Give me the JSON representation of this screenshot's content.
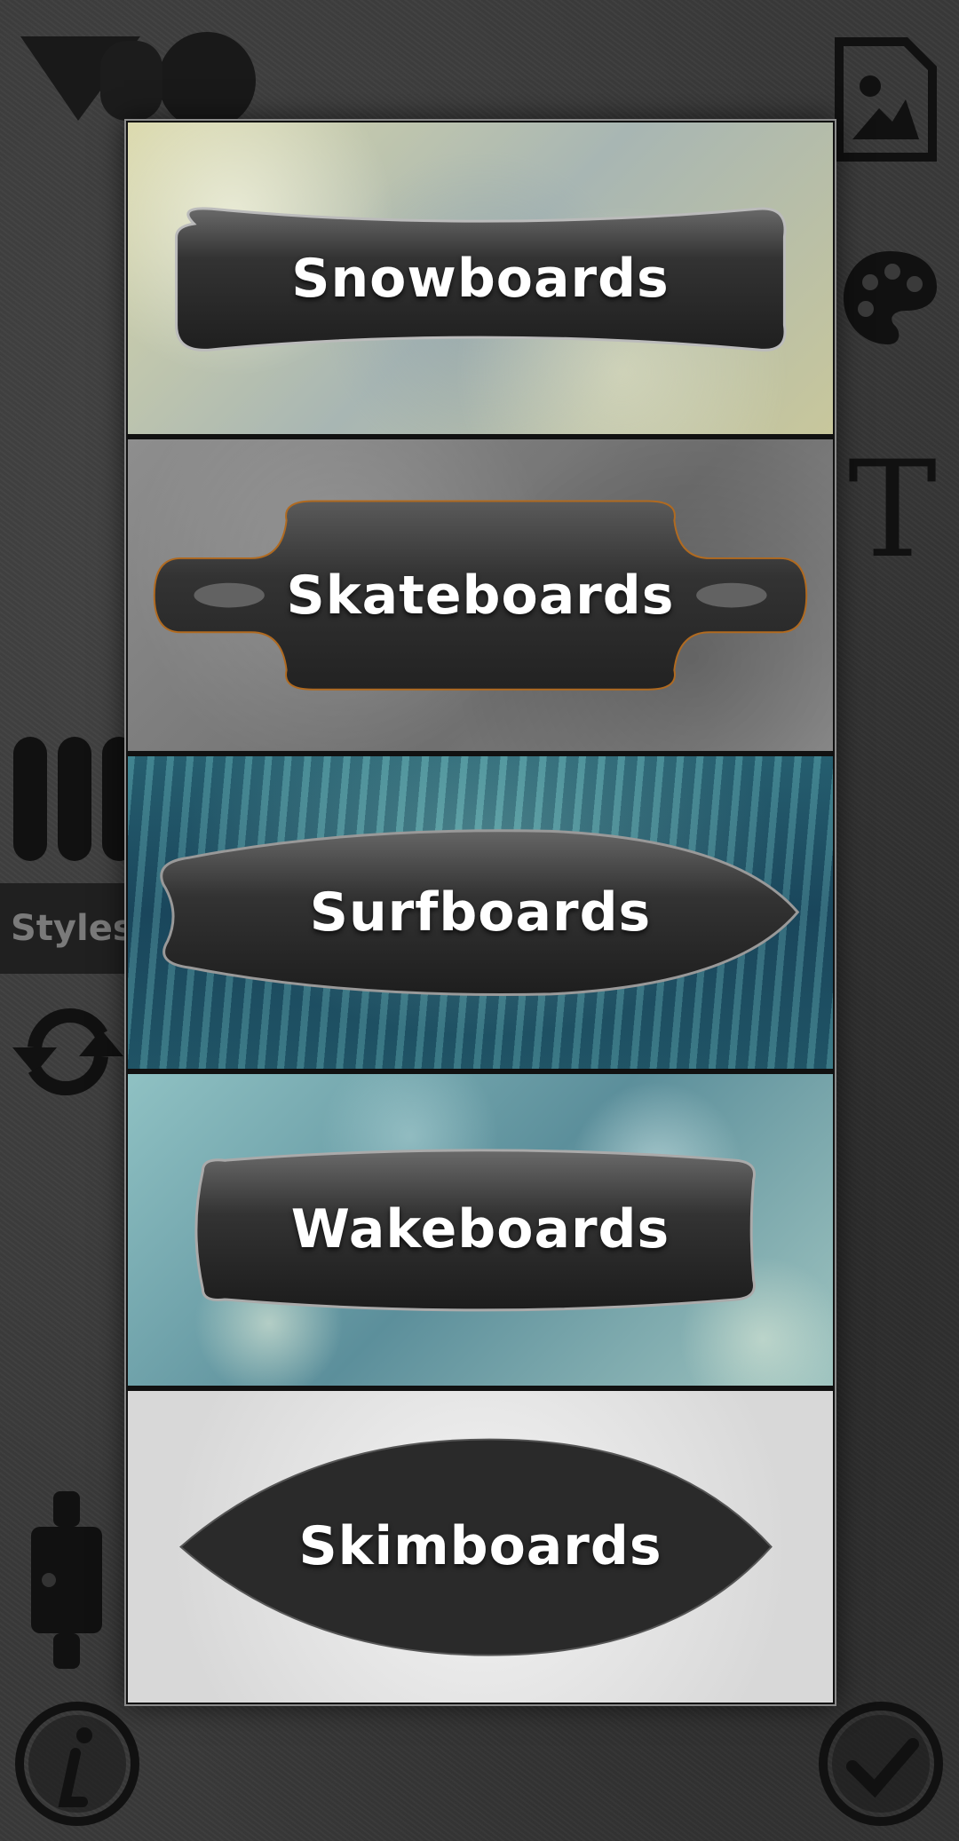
{
  "app": {
    "styles_tab_label": "Styles",
    "text_tool_glyph": "T"
  },
  "board_menu": {
    "items": [
      {
        "label": "Snowboards",
        "background": "snow"
      },
      {
        "label": "Skateboards",
        "background": "concrete"
      },
      {
        "label": "Surfboards",
        "background": "water"
      },
      {
        "label": "Wakeboards",
        "background": "bokeh"
      },
      {
        "label": "Skimboards",
        "background": "crumpled-paper"
      }
    ]
  },
  "icons": {
    "logo": "logo-icon",
    "image": "image-icon",
    "palette": "palette-icon",
    "text": "text-icon",
    "bars": "bars-icon",
    "refresh": "refresh-icon",
    "truck": "truck-icon",
    "info": "info-icon",
    "check": "check-icon"
  },
  "colors": {
    "background": "#3a3a3a",
    "board_fill": "#2a2a2a",
    "label": "#ffffff",
    "icon": "#111111"
  }
}
